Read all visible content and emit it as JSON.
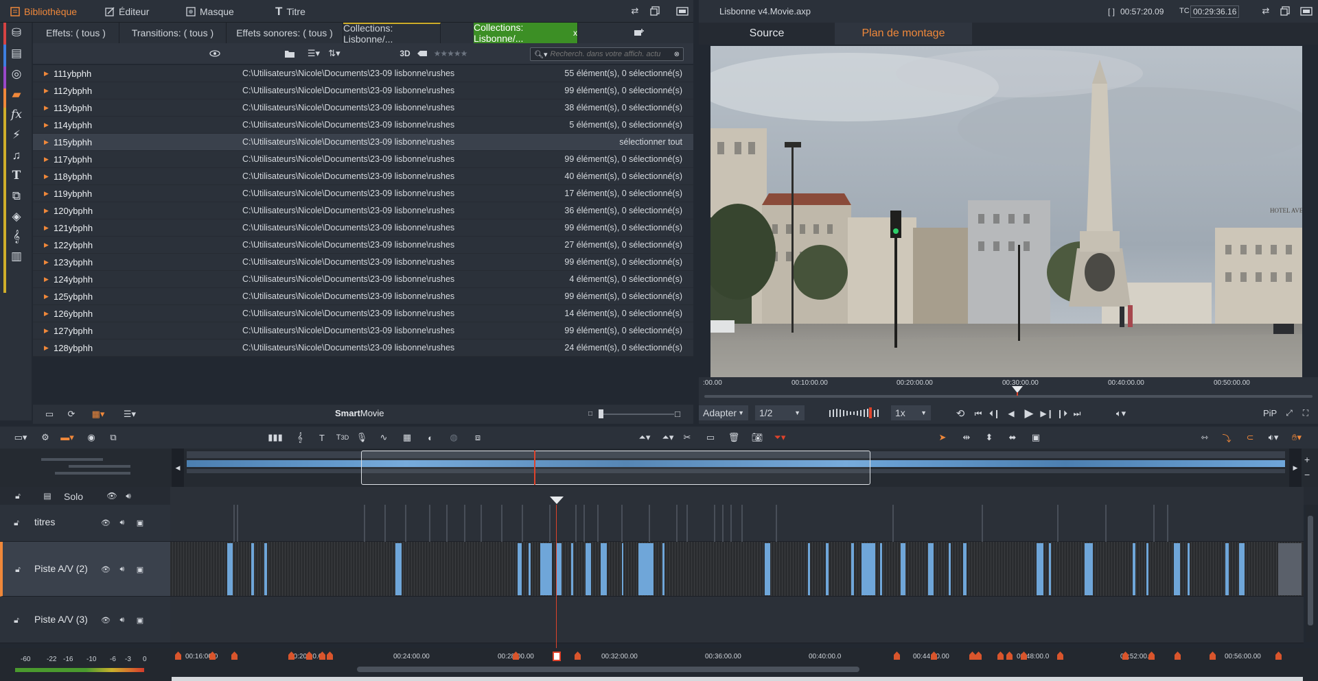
{
  "menubar": {
    "tabs": [
      {
        "label": "Bibliothèque",
        "icon": "library-icon",
        "active": true
      },
      {
        "label": "Éditeur",
        "icon": "editor-icon",
        "active": false
      },
      {
        "label": "Masque",
        "icon": "mask-icon",
        "active": false
      },
      {
        "label": "Titre",
        "icon": "title-icon",
        "active": false
      }
    ]
  },
  "library": {
    "tabs": [
      {
        "label": "Effets: ( tous )"
      },
      {
        "label": "Transitions: ( tous )"
      },
      {
        "label": "Effets sonores: ( tous )"
      },
      {
        "label": "Collections: Lisbonne/..."
      },
      {
        "label": "Collections: Lisbonne/...",
        "active": true,
        "close": "x"
      }
    ],
    "toolbar": {
      "three_d": "3D",
      "search_placeholder": "Recherch. dans votre affich. actu"
    },
    "rows": [
      {
        "name": "111ybphh",
        "path": "C:\\Utilisateurs\\Nicole\\Documents\\23-09 lisbonne\\rushes",
        "count": "55 élément(s), 0 sélectionné(s)"
      },
      {
        "name": "112ybphh",
        "path": "C:\\Utilisateurs\\Nicole\\Documents\\23-09 lisbonne\\rushes",
        "count": "99 élément(s), 0 sélectionné(s)"
      },
      {
        "name": "113ybphh",
        "path": "C:\\Utilisateurs\\Nicole\\Documents\\23-09 lisbonne\\rushes",
        "count": "38 élément(s), 0 sélectionné(s)"
      },
      {
        "name": "114ybphh",
        "path": "C:\\Utilisateurs\\Nicole\\Documents\\23-09 lisbonne\\rushes",
        "count": "5 élément(s), 0 sélectionné(s)"
      },
      {
        "name": "115ybphh",
        "path": "C:\\Utilisateurs\\Nicole\\Documents\\23-09 lisbonne\\rushes",
        "count": "sélectionner tout",
        "highlighted": true
      },
      {
        "name": "117ybphh",
        "path": "C:\\Utilisateurs\\Nicole\\Documents\\23-09 lisbonne\\rushes",
        "count": "99 élément(s), 0 sélectionné(s)"
      },
      {
        "name": "118ybphh",
        "path": "C:\\Utilisateurs\\Nicole\\Documents\\23-09 lisbonne\\rushes",
        "count": "40 élément(s), 0 sélectionné(s)"
      },
      {
        "name": "119ybphh",
        "path": "C:\\Utilisateurs\\Nicole\\Documents\\23-09 lisbonne\\rushes",
        "count": "17 élément(s), 0 sélectionné(s)"
      },
      {
        "name": "120ybphh",
        "path": "C:\\Utilisateurs\\Nicole\\Documents\\23-09 lisbonne\\rushes",
        "count": "36 élément(s), 0 sélectionné(s)"
      },
      {
        "name": "121ybphh",
        "path": "C:\\Utilisateurs\\Nicole\\Documents\\23-09 lisbonne\\rushes",
        "count": "99 élément(s), 0 sélectionné(s)"
      },
      {
        "name": "122ybphh",
        "path": "C:\\Utilisateurs\\Nicole\\Documents\\23-09 lisbonne\\rushes",
        "count": "27 élément(s), 0 sélectionné(s)"
      },
      {
        "name": "123ybphh",
        "path": "C:\\Utilisateurs\\Nicole\\Documents\\23-09 lisbonne\\rushes",
        "count": "99 élément(s), 0 sélectionné(s)"
      },
      {
        "name": "124ybphh",
        "path": "C:\\Utilisateurs\\Nicole\\Documents\\23-09 lisbonne\\rushes",
        "count": "4 élément(s), 0 sélectionné(s)"
      },
      {
        "name": "125ybphh",
        "path": "C:\\Utilisateurs\\Nicole\\Documents\\23-09 lisbonne\\rushes",
        "count": "99 élément(s), 0 sélectionné(s)"
      },
      {
        "name": "126ybphh",
        "path": "C:\\Utilisateurs\\Nicole\\Documents\\23-09 lisbonne\\rushes",
        "count": "14 élément(s), 0 sélectionné(s)"
      },
      {
        "name": "127ybphh",
        "path": "C:\\Utilisateurs\\Nicole\\Documents\\23-09 lisbonne\\rushes",
        "count": "99 élément(s), 0 sélectionné(s)"
      },
      {
        "name": "128ybphh",
        "path": "C:\\Utilisateurs\\Nicole\\Documents\\23-09 lisbonne\\rushes",
        "count": "24 élément(s), 0 sélectionné(s)"
      }
    ],
    "bottom": {
      "smartmovie_bold": "Smart",
      "smartmovie_rest": "Movie"
    }
  },
  "preview": {
    "project_title": "Lisbonne v4.Movie.axp",
    "in_out_label": "[ ]",
    "duration": "00:57:20.09",
    "tc_label": "TC",
    "timecode": "00:29:36.16",
    "tabs": [
      {
        "label": "Source",
        "active": false
      },
      {
        "label": "Plan de montage",
        "active": true
      }
    ],
    "ruler_labels": [
      ":00.00",
      "00:10:00.00",
      "00:20:00.00",
      "00:30:00.00",
      "00:40:00.00",
      "00:50:00.00"
    ],
    "fit_label": "Adapter",
    "quality": "1/2",
    "speed": "1x",
    "pip_label": "PiP",
    "sign_text": "HOTEL AVENIDA PAL"
  },
  "timeline": {
    "solo_label": "Solo",
    "tracks": [
      {
        "label": "titres"
      },
      {
        "label": "Piste A/V (2)"
      },
      {
        "label": "Piste A/V (3)"
      }
    ],
    "meter_labels": [
      "-60",
      "-22",
      "-16",
      "-10",
      "-6",
      "-3",
      "0"
    ],
    "ruler_labels": [
      "00:16:00.0",
      "00:20:00.0",
      "00:24:00.00",
      "00:28:00.00",
      "00:32:00.00",
      "00:36:00.00",
      "00:40:00.0",
      "00:44:00.00",
      "00:48:00.0",
      "00:52:00.0",
      "00:56:00.00"
    ],
    "playhead_time": "00:29:36.16"
  },
  "colors": {
    "accent_orange": "#f0883a",
    "active_tab_green": "#3c8f25",
    "clip_blue": "#6fa6d9",
    "playhead_red": "#e0432b"
  }
}
